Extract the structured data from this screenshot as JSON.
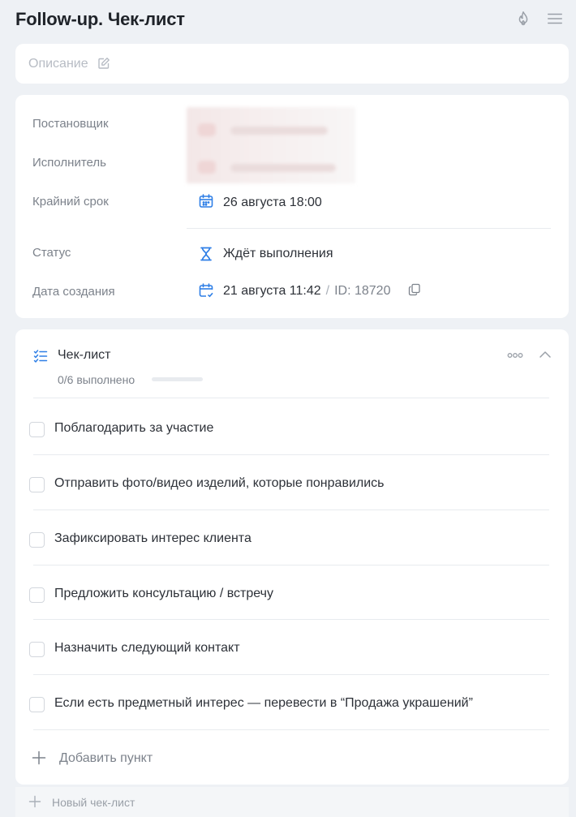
{
  "header": {
    "title": "Follow-up. Чек-лист",
    "icons": {
      "fire": "fire-icon",
      "menu": "menu-icon"
    }
  },
  "description": {
    "placeholder": "Описание",
    "edit_icon": "edit-icon"
  },
  "info": {
    "creator_label": "Постановщик",
    "assignee_label": "Исполнитель",
    "deadline_label": "Крайний срок",
    "deadline_value": "26 августа 18:00",
    "status_label": "Статус",
    "status_value": "Ждёт выполнения",
    "created_label": "Дата создания",
    "created_value": "21 августа 11:42",
    "id_separator": "/",
    "id_value": "ID: 18720"
  },
  "checklist": {
    "title": "Чек-лист",
    "progress_text": "0/6 выполнено",
    "progress_fraction": 0,
    "items": [
      {
        "label": "Поблагодарить за участие",
        "checked": false
      },
      {
        "label": "Отправить фото/видео изделий, которые понравились",
        "checked": false
      },
      {
        "label": "Зафиксировать интерес клиента",
        "checked": false
      },
      {
        "label": "Предложить консультацию / встречу",
        "checked": false
      },
      {
        "label": "Назначить следующий контакт",
        "checked": false
      },
      {
        "label": "Если есть предметный интерес — перевести в “Продажа украшений”",
        "checked": false
      }
    ],
    "add_item_label": "Добавить пункт"
  },
  "new_checklist_label": "Новый чек-лист",
  "colors": {
    "accent": "#2f7fe6",
    "background": "#eef1f5",
    "card": "#ffffff",
    "label_gray": "#7c828b"
  }
}
